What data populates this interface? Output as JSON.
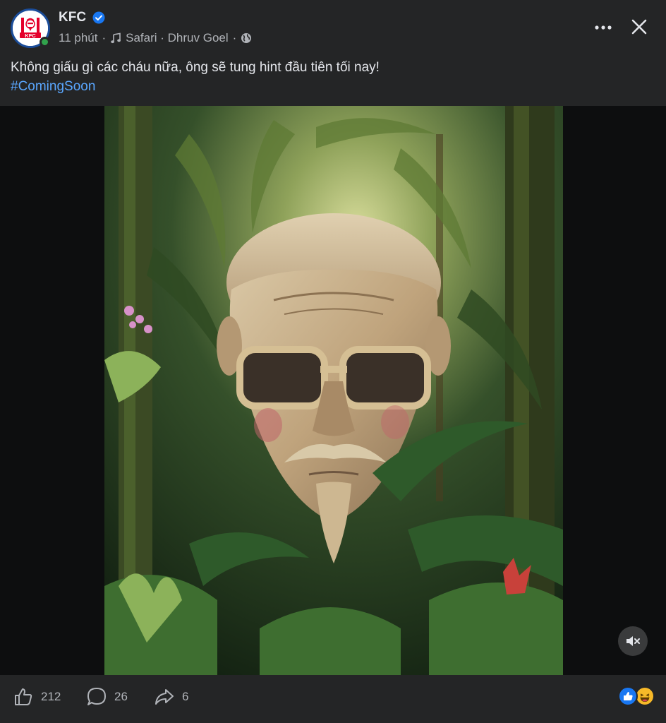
{
  "post": {
    "page_name": "KFC",
    "time": "11 phút",
    "separator": "·",
    "music_label": "Safari · Dhruv Goel",
    "caption": "Không giấu gì các cháu nữa, ông sẽ tung hint đầu tiên tối nay!",
    "hashtag": "#ComingSoon"
  },
  "logo": {
    "text": "KFC"
  },
  "engagement": {
    "likes": "212",
    "comments": "26",
    "shares": "6"
  },
  "icons": {
    "verified": "verified-badge-icon",
    "music": "music-note-icon",
    "privacy": "globe-icon",
    "more": "more-dots-icon",
    "close": "close-icon",
    "mute": "muted-speaker-icon",
    "like": "thumbs-up-icon",
    "comment": "comment-bubble-icon",
    "share": "share-arrow-icon",
    "reactions": [
      "like-reaction-icon",
      "haha-reaction-icon"
    ]
  },
  "colors": {
    "background": "#242526",
    "text": "#e4e6eb",
    "muted": "#b0b3b8",
    "link": "#5aa7ff",
    "verified": "#1877f2",
    "online": "#31a24c",
    "kfc_red": "#e4002b"
  }
}
